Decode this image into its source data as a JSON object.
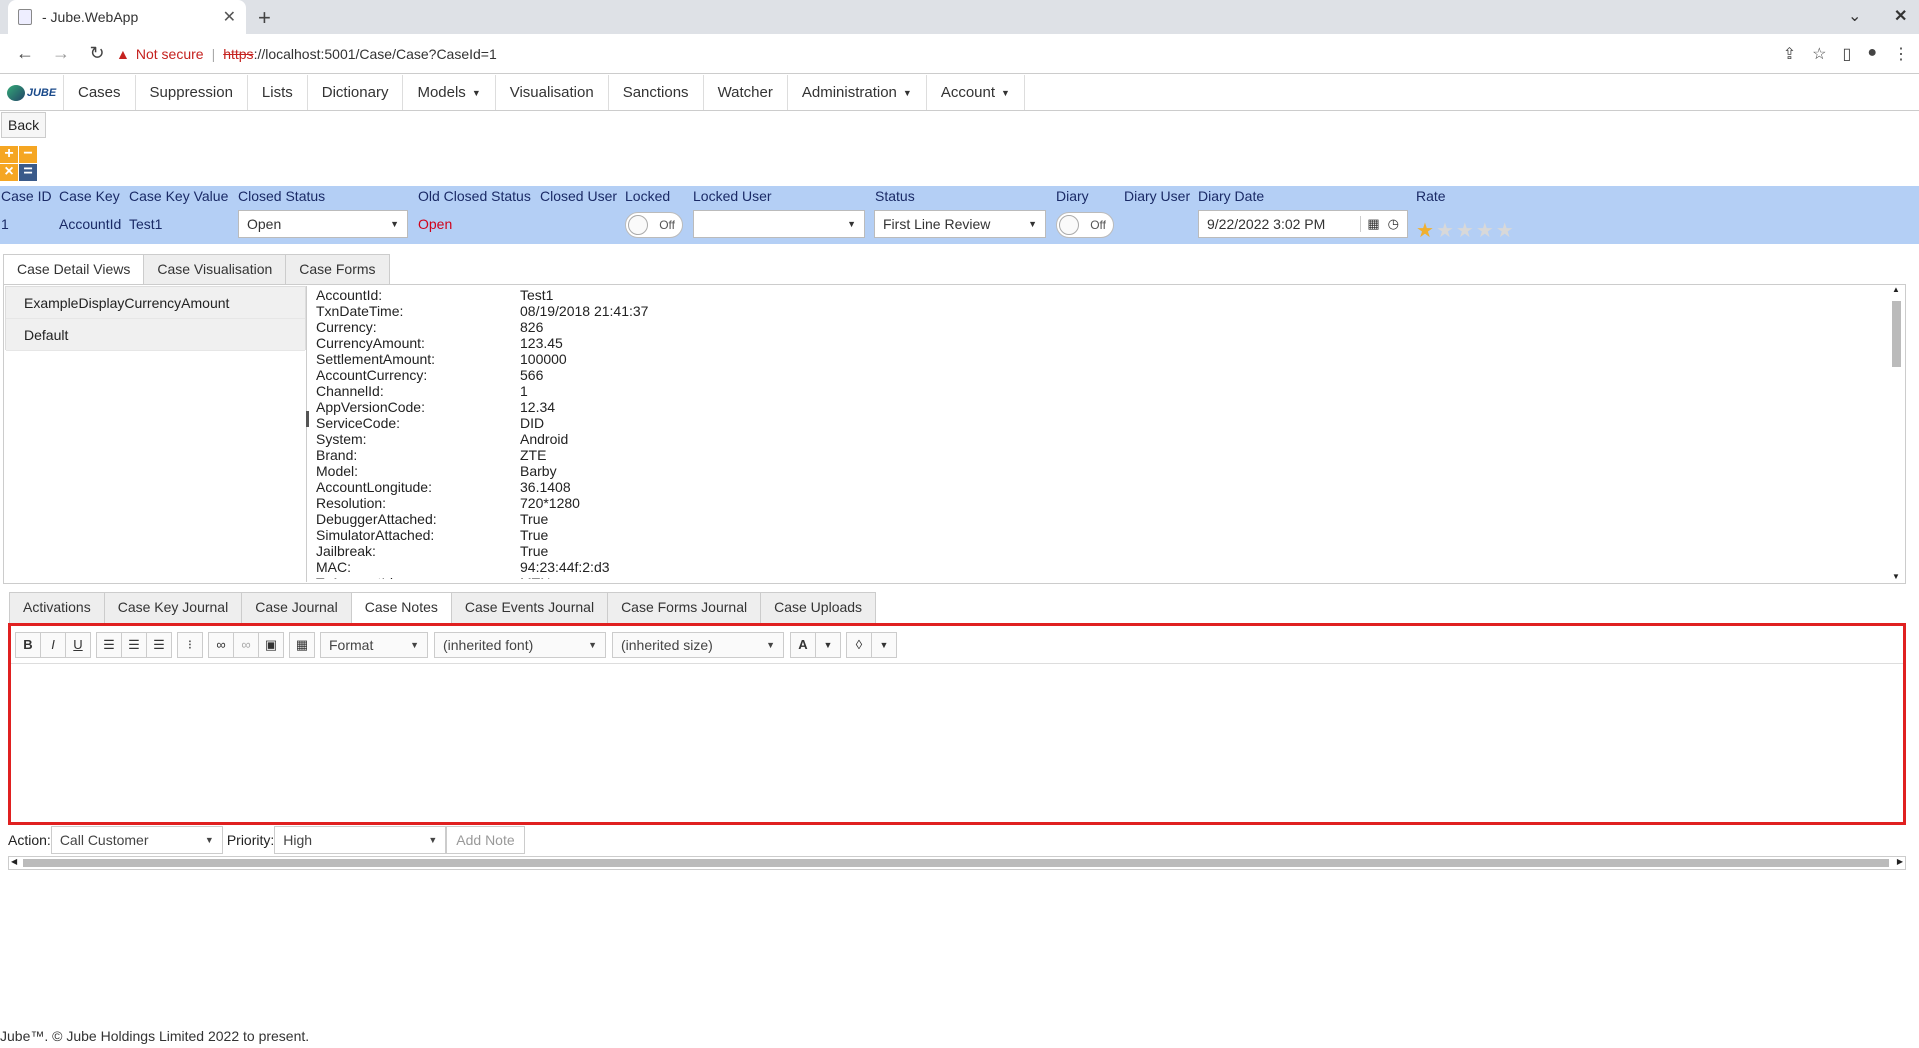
{
  "browser": {
    "tab_title": "- Jube.WebApp",
    "tab_close": "✕",
    "new_tab": "+",
    "not_secure": "Not secure",
    "url_scheme": "https",
    "url_rest": "://localhost:5001/Case/Case?CaseId=1"
  },
  "nav": {
    "logo_text": "JUBE",
    "items": [
      "Cases",
      "Suppression",
      "Lists",
      "Dictionary",
      "Models",
      "Visualisation",
      "Sanctions",
      "Watcher",
      "Administration",
      "Account"
    ]
  },
  "page": {
    "back_label": "Back",
    "calc_symbols": [
      "+",
      "−",
      "×",
      "="
    ]
  },
  "case": {
    "labels": {
      "case_id": "Case ID",
      "case_key": "Case Key",
      "case_key_value": "Case Key Value",
      "closed_status": "Closed Status",
      "old_closed_status": "Old Closed Status",
      "closed_user": "Closed User",
      "locked": "Locked",
      "locked_user": "Locked User",
      "status": "Status",
      "diary": "Diary",
      "diary_user": "Diary User",
      "diary_date": "Diary Date",
      "rate": "Rate"
    },
    "values": {
      "case_id": "1",
      "case_key": "AccountId",
      "case_key_value": "Test1",
      "closed_status": "Open",
      "old_closed_status": "Open",
      "locked": "Off",
      "status": "First Line Review",
      "diary": "Off",
      "diary_date": "9/22/2022 3:02 PM",
      "rate": 1,
      "rate_max": 5
    }
  },
  "tabs_top": [
    "Case Detail Views",
    "Case Visualisation",
    "Case Forms"
  ],
  "detail_views": [
    "ExampleDisplayCurrencyAmount",
    "Default"
  ],
  "fields": [
    [
      "AccountId:",
      "Test1"
    ],
    [
      "TxnDateTime:",
      "08/19/2018 21:41:37"
    ],
    [
      "Currency:",
      "826"
    ],
    [
      "CurrencyAmount:",
      "123.45"
    ],
    [
      "SettlementAmount:",
      "100000"
    ],
    [
      "AccountCurrency:",
      "566"
    ],
    [
      "ChannelId:",
      "1"
    ],
    [
      "AppVersionCode:",
      "12.34"
    ],
    [
      "ServiceCode:",
      "DID"
    ],
    [
      "System:",
      "Android"
    ],
    [
      "Brand:",
      "ZTE"
    ],
    [
      "Model:",
      "Barby"
    ],
    [
      "AccountLongitude:",
      "36.1408"
    ],
    [
      "Resolution:",
      "720*1280"
    ],
    [
      "DebuggerAttached:",
      "True"
    ],
    [
      "SimulatorAttached:",
      "True"
    ],
    [
      "Jailbreak:",
      "True"
    ],
    [
      "MAC:",
      "94:23:44f:2:d3"
    ],
    [
      "ToAccountId:",
      "MTN"
    ]
  ],
  "tabs_bottom": [
    "Activations",
    "Case Key Journal",
    "Case Journal",
    "Case Notes",
    "Case Events Journal",
    "Case Forms Journal",
    "Case Uploads"
  ],
  "editor": {
    "format": "Format",
    "font": "(inherited font)",
    "size": "(inherited size)"
  },
  "note_actions": {
    "action_label": "Action:",
    "action_value": "Call Customer",
    "priority_label": "Priority:",
    "priority_value": "High",
    "add_note": "Add Note"
  },
  "footer": "Jube™. © Jube Holdings Limited 2022 to present.",
  "colors": {
    "header_strip": "#b4cff5",
    "accent_red": "#e02020",
    "star_on": "#f0b030",
    "star_off": "#d8d8d8"
  }
}
